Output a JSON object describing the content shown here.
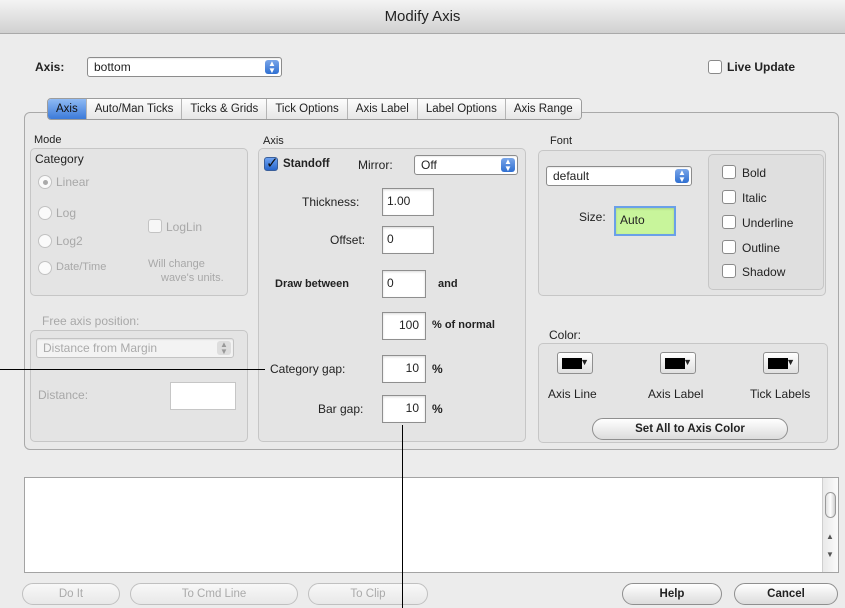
{
  "window": {
    "title": "Modify Axis"
  },
  "header": {
    "axis_label": "Axis:",
    "axis_value": "bottom",
    "live_update_label": "Live Update"
  },
  "tabs": [
    {
      "label": "Axis",
      "active": true
    },
    {
      "label": "Auto/Man Ticks"
    },
    {
      "label": "Ticks & Grids"
    },
    {
      "label": "Tick Options"
    },
    {
      "label": "Axis Label"
    },
    {
      "label": "Label Options"
    },
    {
      "label": "Axis Range"
    }
  ],
  "mode": {
    "title": "Mode",
    "group_title": "Category",
    "options": [
      {
        "label": "Linear",
        "selected": true
      },
      {
        "label": "Log"
      },
      {
        "label": "Log2"
      },
      {
        "label": "Date/Time"
      }
    ],
    "loglin_label": "LogLin",
    "note_line1": "Will change",
    "note_line2": "wave's units.",
    "free_axis_label": "Free axis position:",
    "free_axis_value": "Distance from Margin",
    "distance_label": "Distance:"
  },
  "axis": {
    "title": "Axis",
    "standoff_label": "Standoff",
    "mirror_label": "Mirror:",
    "mirror_value": "Off",
    "thickness_label": "Thickness:",
    "thickness_value": "1.00",
    "offset_label": "Offset:",
    "offset_value": "0",
    "draw_between_label": "Draw between",
    "draw_between_value": "0",
    "and_label": "and",
    "pct_value": "100",
    "pct_label": "% of normal",
    "category_gap_label": "Category gap:",
    "category_gap_value": "10",
    "category_gap_unit": "%",
    "bar_gap_label": "Bar gap:",
    "bar_gap_value": "10",
    "bar_gap_unit": "%"
  },
  "font": {
    "title": "Font",
    "font_value": "default",
    "size_label": "Size:",
    "size_value": "Auto",
    "styles": [
      "Bold",
      "Italic",
      "Underline",
      "Outline",
      "Shadow"
    ]
  },
  "color": {
    "title": "Color:",
    "swatches": [
      {
        "label": "Axis Line",
        "color": "#000000"
      },
      {
        "label": "Axis Label",
        "color": "#000000"
      },
      {
        "label": "Tick Labels",
        "color": "#000000"
      }
    ],
    "set_all_label": "Set All to Axis Color"
  },
  "footer": {
    "do_it": "Do It",
    "to_cmd_line": "To Cmd Line",
    "to_clip": "To Clip",
    "help": "Help",
    "cancel": "Cancel"
  },
  "colors": {
    "accent": "#3c7ad9",
    "size_field_bg": "#c8f59b"
  }
}
